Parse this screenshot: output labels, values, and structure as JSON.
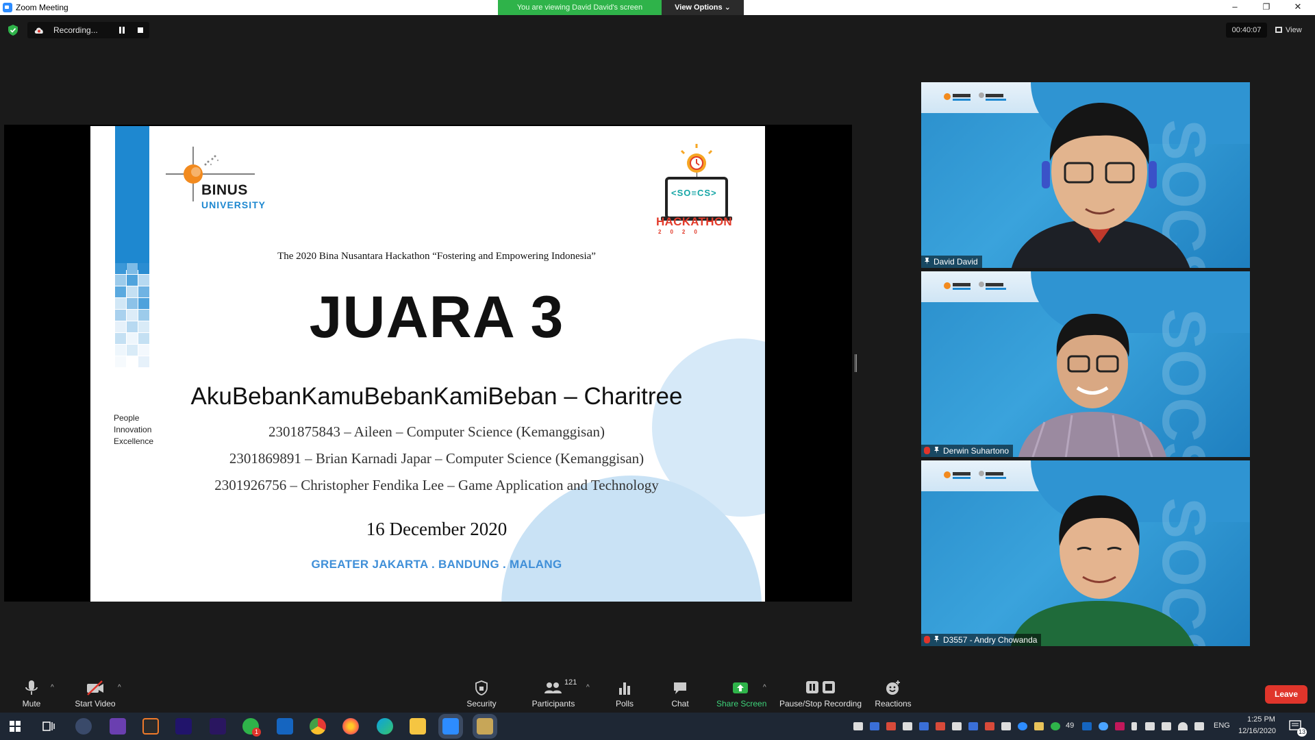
{
  "window": {
    "title": "Zoom Meeting",
    "viewing_banner": "You are viewing David David's screen",
    "view_options": "View Options ⌄",
    "minimize": "–",
    "restore": "❐",
    "close": "✕"
  },
  "recording": {
    "label": "Recording..."
  },
  "meeting_timer": "00:40:07",
  "view_label": "View",
  "slide": {
    "logo_name": "BINUS",
    "logo_sub": "UNIVERSITY",
    "tagline": [
      "People",
      "Innovation",
      "Excellence"
    ],
    "hackathon_title": "HACKATHON",
    "hackathon_year": "2020",
    "hackathon_screen": "<SO≡CS>",
    "subtitle": "The 2020 Bina Nusantara Hackathon “Fostering and Empowering Indonesia”",
    "heading": "JUARA 3",
    "team": "AkuBebanKamuBebanKamiBeban – Charitree",
    "members": [
      "2301875843 – Aileen – Computer Science (Kemanggisan)",
      "2301869891 – Brian Karnadi Japar – Computer Science (Kemanggisan)",
      "2301926756 – Christopher Fendika Lee – Game Application and Technology"
    ],
    "date": "16 December 2020",
    "campuses": "GREATER JAKARTA . BANDUNG . MALANG"
  },
  "participants_video": [
    {
      "name": "David David",
      "muted": false
    },
    {
      "name": "Derwin Suhartono",
      "muted": true
    },
    {
      "name": "D3557 - Andry Chowanda",
      "muted": true
    }
  ],
  "toolbar": {
    "mute": "Mute",
    "start_video": "Start Video",
    "security": "Security",
    "participants": "Participants",
    "participants_count": "121",
    "polls": "Polls",
    "chat": "Chat",
    "share_screen": "Share Screen",
    "pause_stop_recording": "Pause/Stop Recording",
    "reactions": "Reactions",
    "leave": "Leave"
  },
  "taskbar": {
    "tray_count": "49",
    "language": "ENG",
    "time": "1:25 PM",
    "date": "12/16/2020",
    "notification_count": "13",
    "whatsapp_badge": "1"
  },
  "colors": {
    "zoom_blue": "#2d8cff",
    "viewing_green": "#2fb34a",
    "leave_red": "#e0352b",
    "binus_blue": "#1e88d0",
    "hackathon_red": "#e23c2c"
  }
}
